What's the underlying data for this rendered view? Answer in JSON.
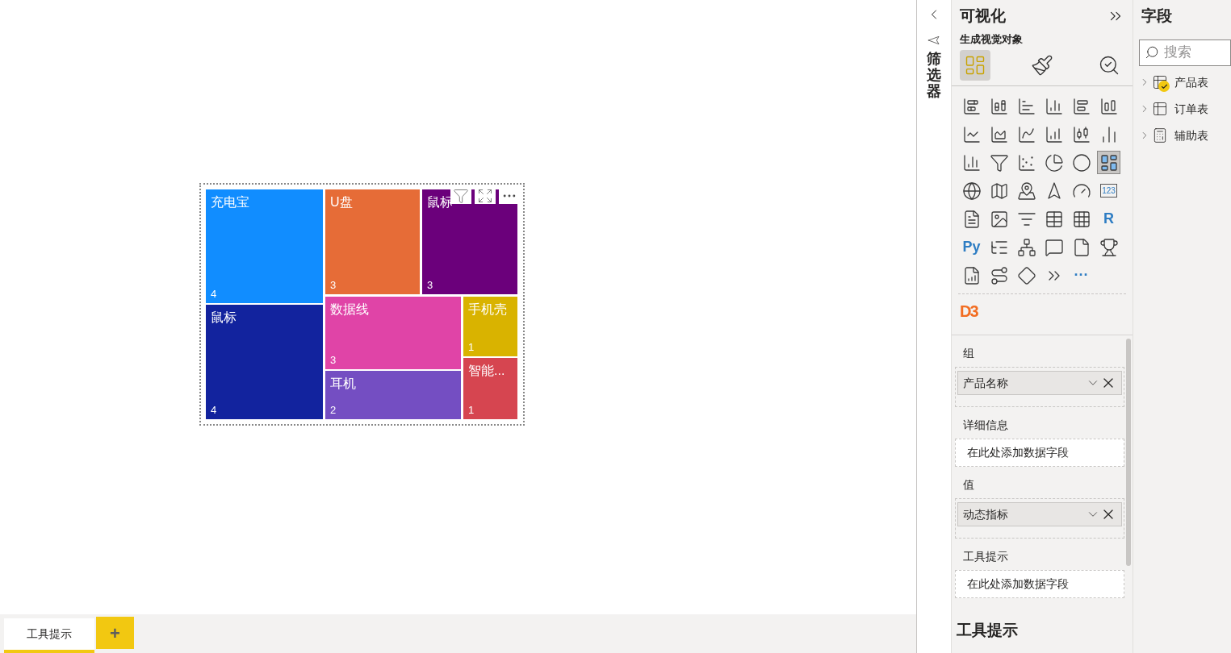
{
  "canvas": {
    "treemap": {
      "tiles": [
        {
          "name": "充电宝",
          "value": "4",
          "color": "#118dff"
        },
        {
          "name": "鼠标",
          "value": "4",
          "color": "#12239e"
        },
        {
          "name": "U盘",
          "value": "3",
          "color": "#e66c37"
        },
        {
          "name": "鼠标",
          "value": "3",
          "color": "#6b007b"
        },
        {
          "name": "数据线",
          "value": "3",
          "color": "#e044a7"
        },
        {
          "name": "耳机",
          "value": "2",
          "color": "#744ec2"
        },
        {
          "name": "手机壳",
          "value": "1",
          "color": "#d9b300"
        },
        {
          "name": "智能...",
          "value": "1",
          "color": "#d64550"
        }
      ]
    }
  },
  "page_tabs": [
    {
      "label": "工具提示",
      "selected": true
    }
  ],
  "add_page_button": {
    "label": "+"
  },
  "filters_pane": {
    "title": "筛选器"
  },
  "visualizations": {
    "title": "可视化",
    "subtitle": "生成视觉对象",
    "build_tabs": [
      {
        "selected": true
      },
      {
        "selected": false
      },
      {
        "selected": false
      }
    ],
    "visual_types": [
      {
        "selected": false
      },
      {
        "selected": false
      },
      {
        "selected": false
      },
      {
        "selected": false
      },
      {
        "selected": false
      },
      {
        "selected": false
      },
      {
        "selected": false
      },
      {
        "selected": false
      },
      {
        "selected": false
      },
      {
        "selected": false
      },
      {
        "selected": false
      },
      {
        "selected": false
      },
      {
        "selected": false
      },
      {
        "selected": false
      },
      {
        "selected": false
      },
      {
        "selected": false
      },
      {
        "selected": false
      },
      {
        "selected": true
      },
      {
        "selected": false
      },
      {
        "selected": false
      },
      {
        "selected": false
      },
      {
        "selected": false
      },
      {
        "selected": false
      },
      {
        "selected": false,
        "label": "123"
      },
      {
        "selected": false
      },
      {
        "selected": false
      },
      {
        "selected": false
      },
      {
        "selected": false
      },
      {
        "selected": false
      },
      {
        "selected": false,
        "label": "R"
      },
      {
        "selected": false,
        "label": "Py"
      },
      {
        "selected": false
      },
      {
        "selected": false
      },
      {
        "selected": false
      },
      {
        "selected": false
      },
      {
        "selected": false
      },
      {
        "selected": false
      },
      {
        "selected": false
      },
      {
        "selected": false
      },
      {
        "selected": false
      },
      {
        "selected": false,
        "label": "···"
      }
    ],
    "custom_visuals": [
      {
        "label": "D3"
      }
    ],
    "wells": [
      {
        "title": "组",
        "field": "产品名称"
      },
      {
        "title": "详细信息",
        "placeholder": "在此处添加数据字段"
      },
      {
        "title": "值",
        "field": "动态指标"
      },
      {
        "title": "工具提示",
        "placeholder": "在此处添加数据字段"
      }
    ],
    "footer_title": "工具提示"
  },
  "fields": {
    "title": "字段",
    "search": {
      "placeholder": "搜索"
    },
    "tables": [
      {
        "name": "产品表",
        "in_use": true,
        "kind": "table"
      },
      {
        "name": "订单表",
        "in_use": false,
        "kind": "table"
      },
      {
        "name": "辅助表",
        "in_use": false,
        "kind": "calc"
      }
    ]
  }
}
